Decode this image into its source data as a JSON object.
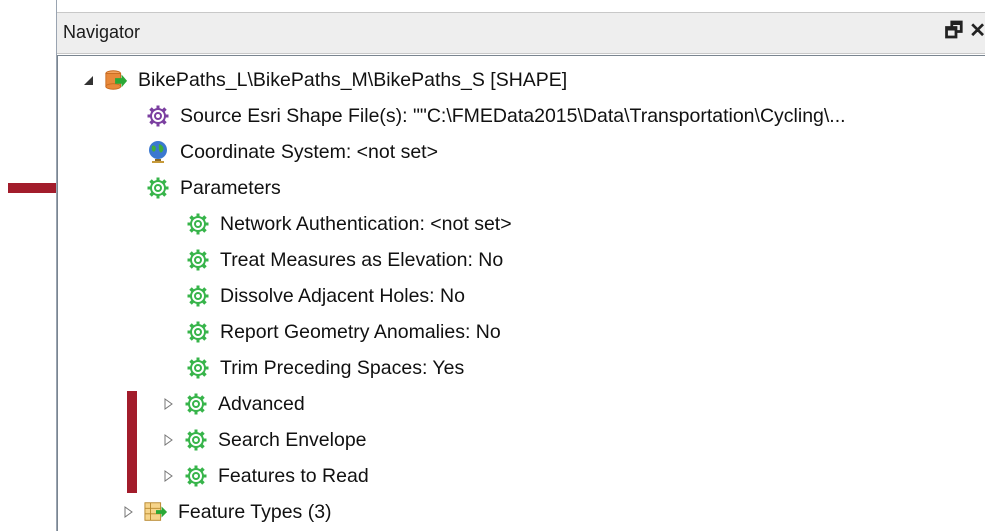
{
  "panel": {
    "title": "Navigator",
    "float_icon_glyph": "🗗",
    "close_icon_glyph": "✕"
  },
  "colors": {
    "gear_green": "#37b44a",
    "gear_purple": "#7b3fa0",
    "annotation_red": "#a21c2b",
    "dataset_orange": "#e8893a",
    "dataset_green_arrow": "#2aa836"
  },
  "tree": {
    "dataset": {
      "label": "BikePaths_L\\BikePaths_M\\BikePaths_S [SHAPE]",
      "expanded": true,
      "icon": "dataset-reader-icon"
    },
    "source": {
      "label": "Source Esri Shape File(s): \"\"C:\\FMEData2015\\Data\\Transportation\\Cycling\\...",
      "icon": "purple-gear-icon"
    },
    "coordinate_system": {
      "label": "Coordinate System: <not set>",
      "icon": "globe-icon"
    },
    "parameters": {
      "label": "Parameters",
      "icon": "green-gear-icon"
    },
    "params": [
      {
        "label": "Network Authentication: <not set>"
      },
      {
        "label": "Treat Measures as Elevation: No"
      },
      {
        "label": "Dissolve Adjacent Holes: No"
      },
      {
        "label": "Report Geometry Anomalies: No"
      },
      {
        "label": "Trim Preceding Spaces: Yes"
      }
    ],
    "groups": [
      {
        "label": "Advanced",
        "expanded": false
      },
      {
        "label": "Search Envelope",
        "expanded": false
      },
      {
        "label": "Features to Read",
        "expanded": false
      }
    ],
    "feature_types": {
      "label": "Feature Types (3)",
      "expanded": false,
      "icon": "feature-types-icon"
    }
  }
}
